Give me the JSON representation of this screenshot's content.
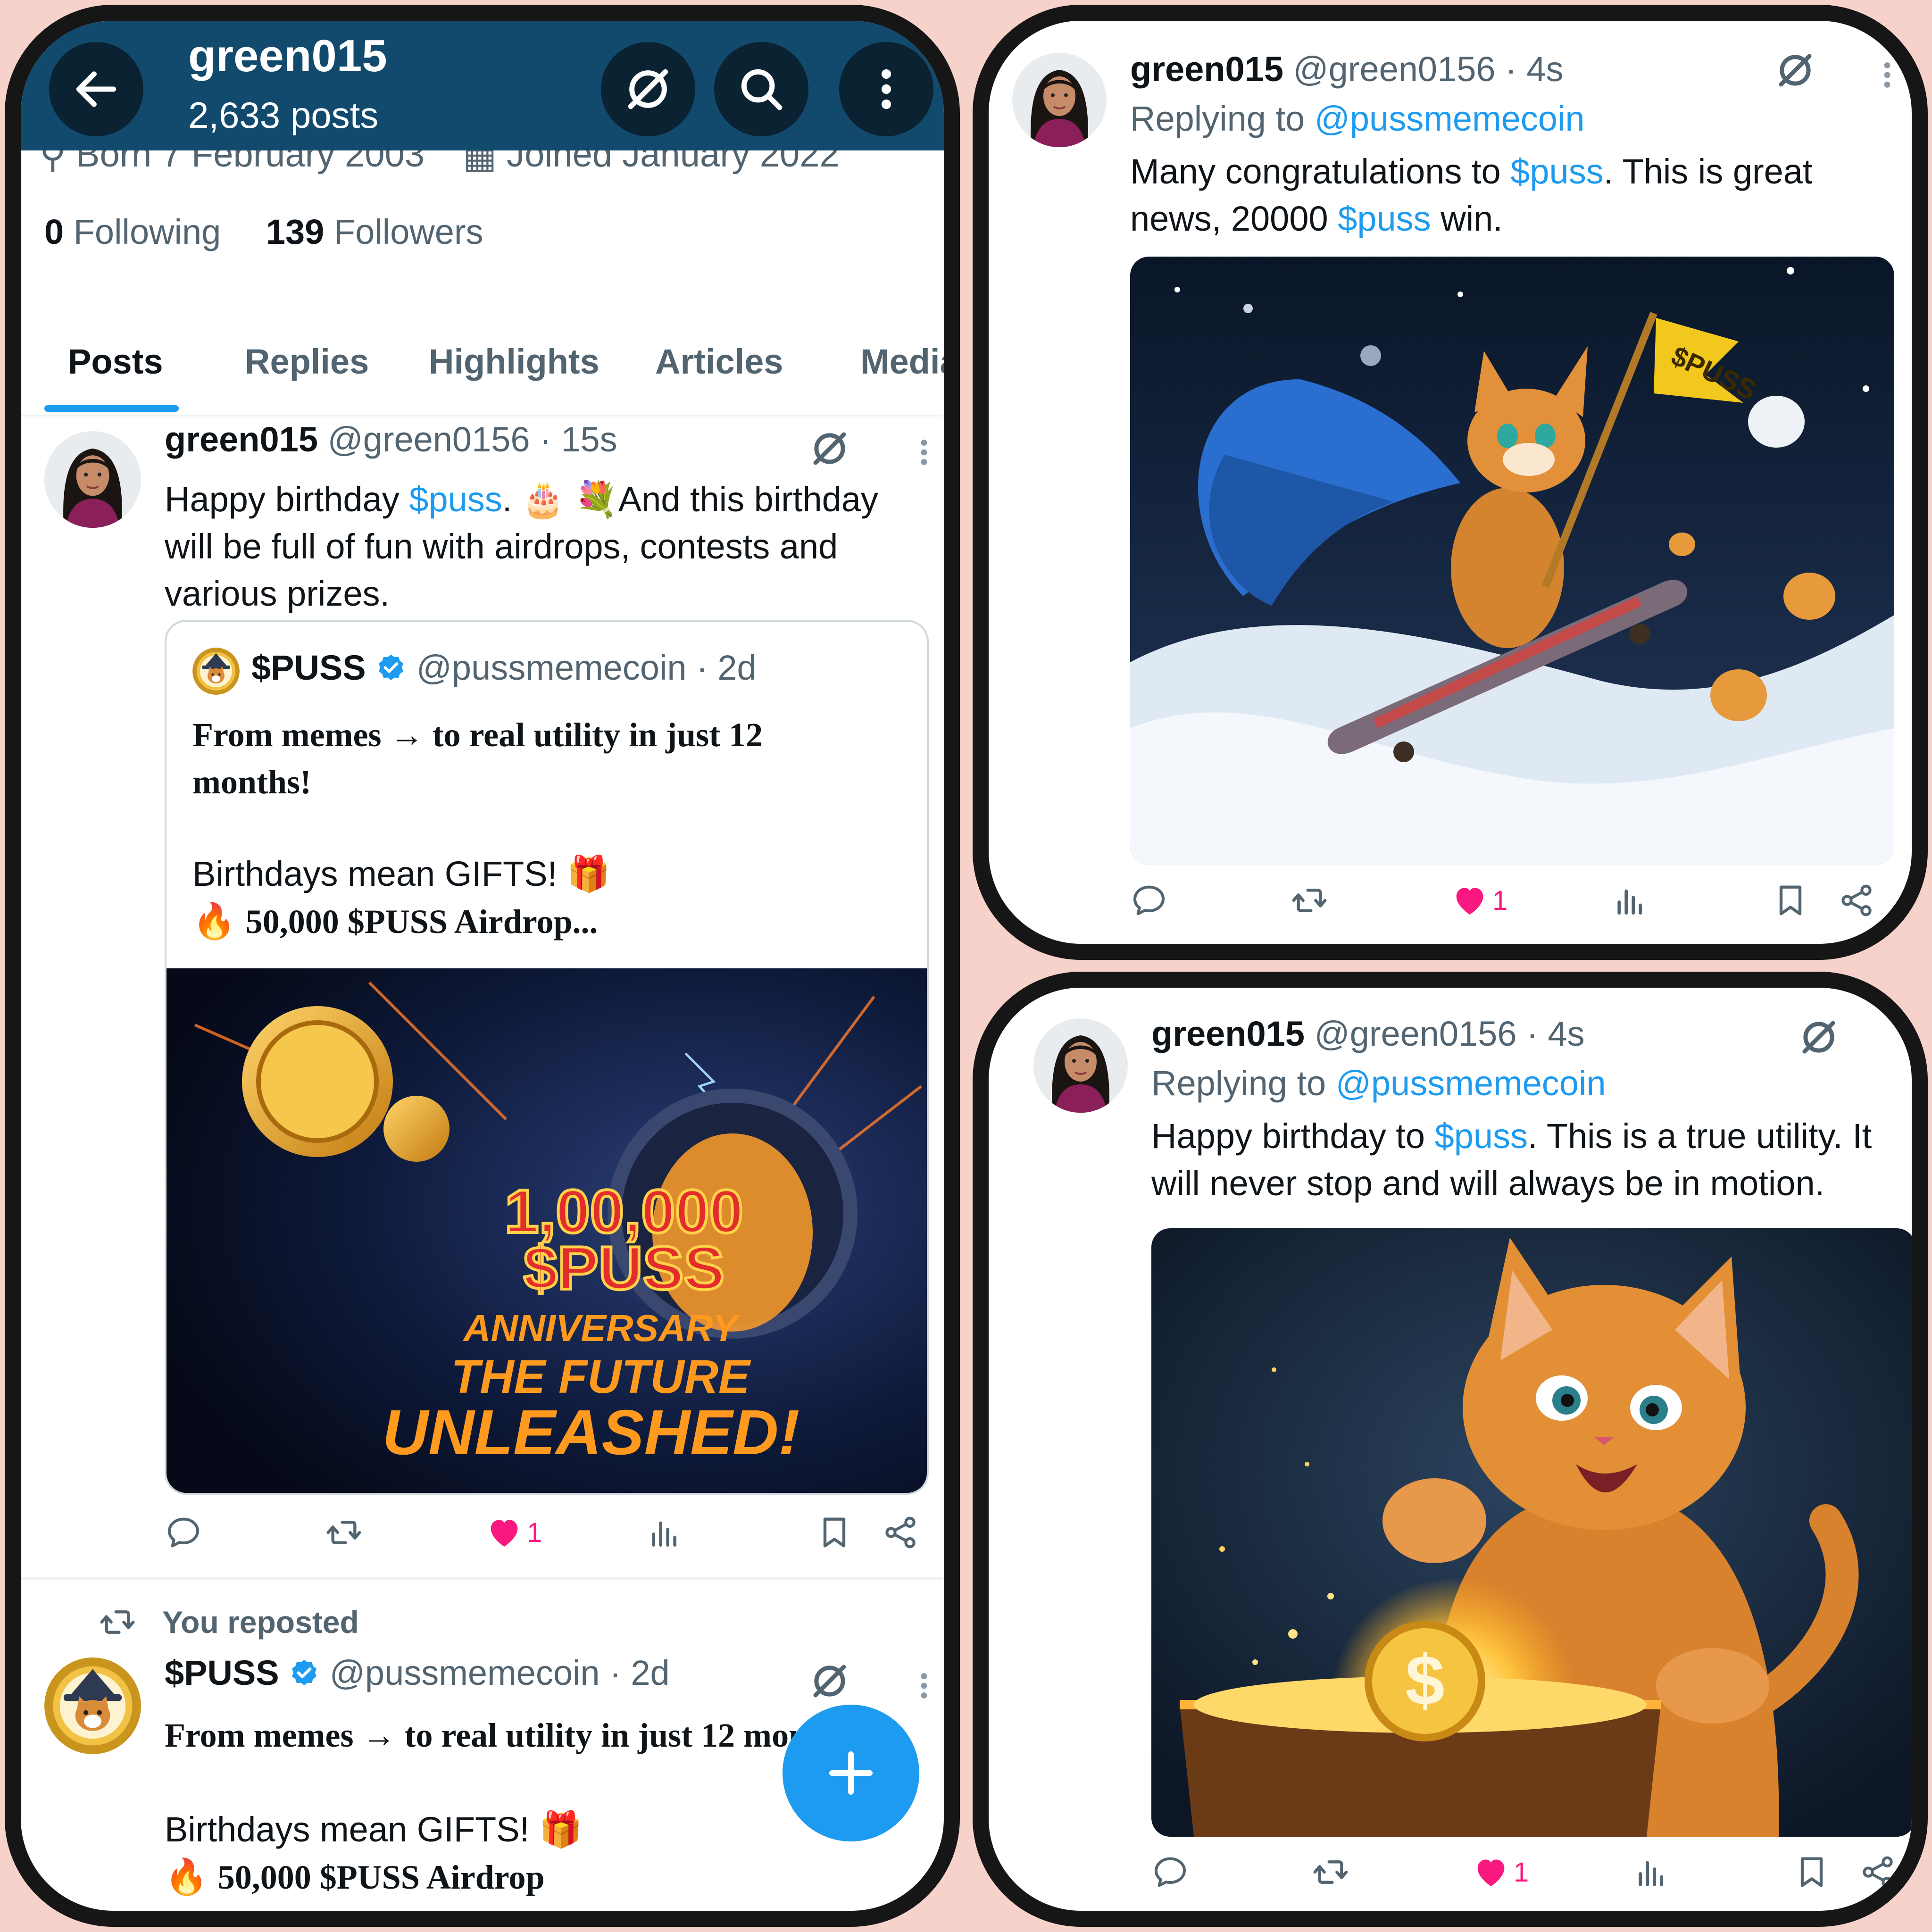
{
  "left": {
    "header": {
      "name": "green015",
      "posts_count": "2,633 posts"
    },
    "profile": {
      "born": "Born 7 February 2003",
      "joined": "Joined January 2022",
      "following_count": "0",
      "following_label": "Following",
      "followers_count": "139",
      "followers_label": "Followers"
    },
    "tabs": [
      "Posts",
      "Replies",
      "Highlights",
      "Articles",
      "Media"
    ],
    "post1": {
      "name": "green015",
      "handle_time": "@green0156 · 15s",
      "text_a": "Happy birthday ",
      "mention": "$puss",
      "text_b": ". 🎂 💐And this birthday will be full of fun with airdrops, contests and various prizes.",
      "quote": {
        "name": "$PUSS",
        "handle_time": "@pussmemecoin · 2d",
        "line1": "From memes → to real utility in just 12 months!",
        "line2": "Birthdays mean GIFTS! 🎁",
        "line3_emoji": "🔥",
        "line3": "50,000 $PUSS Airdrop...",
        "image_text": {
          "amount": "1,00,000",
          "token": "$PUSS",
          "line1": "ANNIVERSARY",
          "line2": "THE FUTURE",
          "line3": "UNLEASHED!"
        }
      },
      "likes": "1"
    },
    "repost": {
      "label": "You reposted",
      "name": "$PUSS",
      "handle_time": "@pussmemecoin · 2d",
      "line1": "From memes → to real utility in just 12 months!",
      "line2": "Birthdays mean GIFTS! 🎁",
      "line3_emoji": "🔥",
      "line3": "50,000 $PUSS Airdrop"
    }
  },
  "right_top": {
    "name": "green015",
    "handle_time": "@green0156 · 4s",
    "replying_prefix": "Replying to ",
    "replying_to": "@pussmemecoin",
    "t1": "Many congratulations to ",
    "m1": "$puss",
    "t2": ". This is great news, 20000 ",
    "m2": "$puss",
    "t3": " win.",
    "flag_text": "$PUSS",
    "likes": "1"
  },
  "right_bottom": {
    "name": "green015",
    "handle_time": "@green0156 · 4s",
    "replying_prefix": "Replying to ",
    "replying_to": "@pussmemecoin",
    "t1": "Happy birthday to ",
    "m1": "$puss",
    "t2": ". This is a true utility. It will never stop and will always be in motion.",
    "coin_symbol": "$",
    "likes": "1"
  },
  "colors": {
    "accent": "#1d9bf0",
    "like": "#f91880",
    "header": "#124a6e",
    "page_bg": "#f7d2cb"
  },
  "icons": [
    "back-arrow-icon",
    "grok-icon",
    "search-icon",
    "more-icon",
    "reply-icon",
    "repost-icon",
    "heart-icon",
    "views-icon",
    "bookmark-icon",
    "share-icon",
    "plus-icon",
    "verified-icon"
  ]
}
